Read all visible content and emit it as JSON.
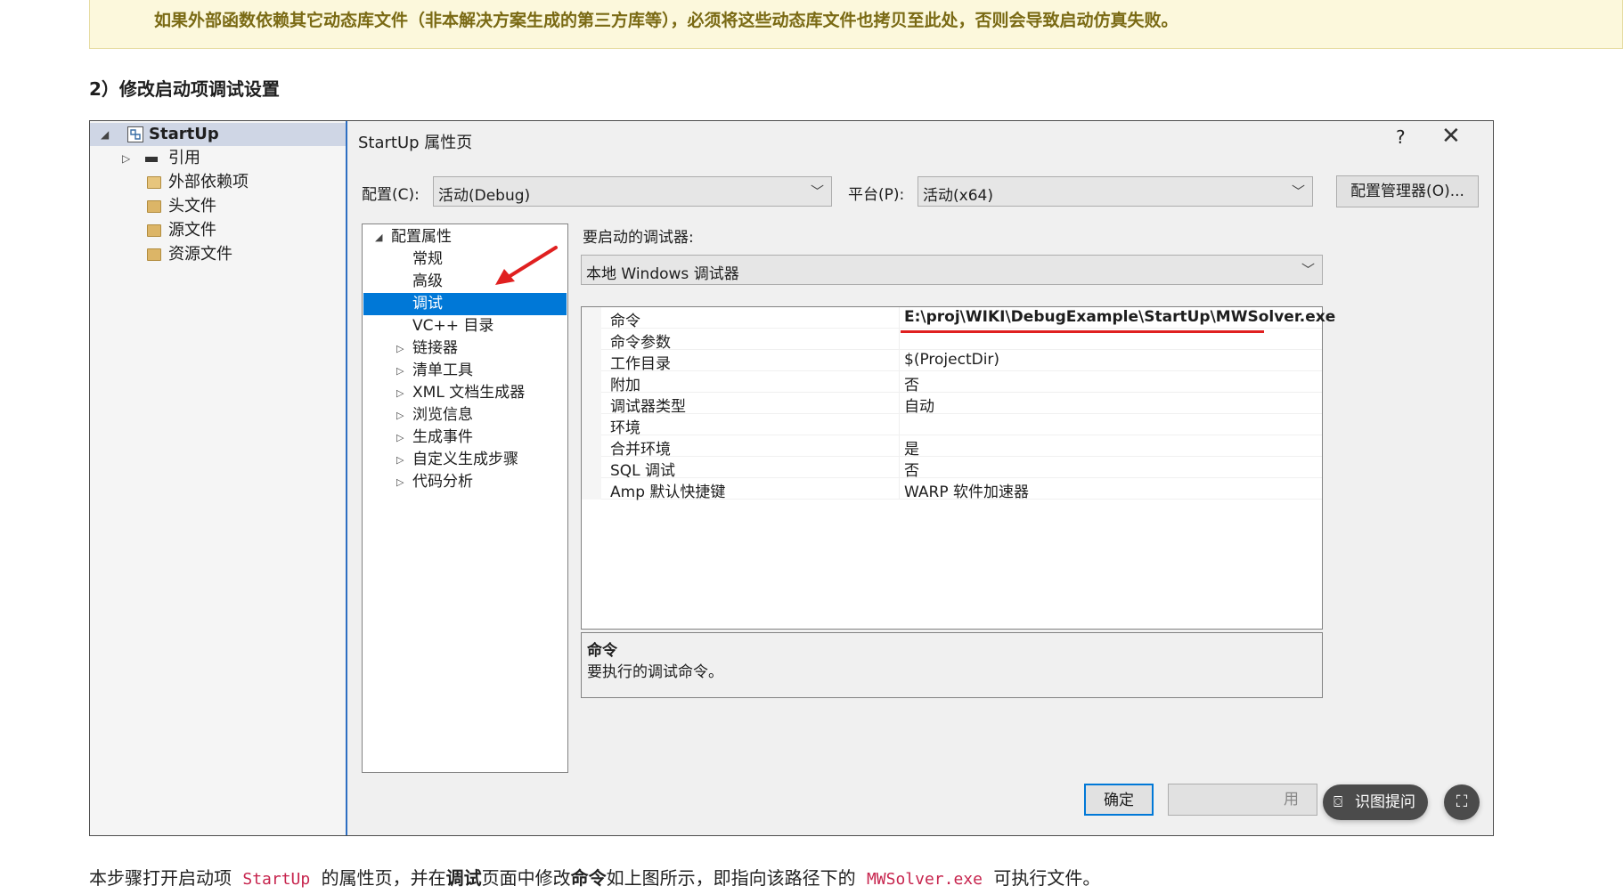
{
  "note": {
    "text": "如果外部函数依赖其它动态库文件（非本解决方案生成的第三方库等），必须将这些动态库文件也拷贝至此处，否则会导致启动仿真失败。"
  },
  "heading": "2）修改启动项调试设置",
  "solution_explorer": {
    "project": "StartUp",
    "items": [
      {
        "label": "引用",
        "icon": "reference-icon"
      },
      {
        "label": "外部依赖项",
        "icon": "external-deps-icon"
      },
      {
        "label": "头文件",
        "icon": "folder-icon"
      },
      {
        "label": "源文件",
        "icon": "folder-icon"
      },
      {
        "label": "资源文件",
        "icon": "folder-icon"
      }
    ]
  },
  "dialog": {
    "title": "StartUp 属性页",
    "help": "?",
    "close": "✕",
    "config_label": "配置(C):",
    "config_value": "活动(Debug)",
    "platform_label": "平台(P):",
    "platform_value": "活动(x64)",
    "config_manager": "配置管理器(O)...",
    "tree": {
      "root": "配置属性",
      "items": [
        "常规",
        "高级",
        "调试",
        "VC++ 目录",
        "链接器",
        "清单工具",
        "XML 文档生成器",
        "浏览信息",
        "生成事件",
        "自定义生成步骤",
        "代码分析"
      ]
    },
    "debugger_label": "要启动的调试器:",
    "debugger_value": "本地 Windows 调试器",
    "props": [
      {
        "k": "命令",
        "v": "E:\\proj\\WIKI\\DebugExample\\StartUp\\MWSolver.exe"
      },
      {
        "k": "命令参数",
        "v": ""
      },
      {
        "k": "工作目录",
        "v": "$(ProjectDir)"
      },
      {
        "k": "附加",
        "v": "否"
      },
      {
        "k": "调试器类型",
        "v": "自动"
      },
      {
        "k": "环境",
        "v": ""
      },
      {
        "k": "合并环境",
        "v": "是"
      },
      {
        "k": "SQL 调试",
        "v": "否"
      },
      {
        "k": "Amp 默认快捷键",
        "v": "WARP 软件加速器"
      }
    ],
    "desc_title": "命令",
    "desc_text": "要执行的调试命令。",
    "ok": "确定",
    "apply_partial": "用"
  },
  "overlay": {
    "ask": "识图提问"
  },
  "caption": {
    "p1": "本步骤打开启动项 ",
    "code1": "StartUp",
    "p2": " 的属性页，并在",
    "b1": "调试",
    "p3": "页面中修改",
    "b2": "命令",
    "p4": "如上图所示，即指向该路径下的 ",
    "code2": "MWSolver.exe",
    "p5": " 可执行文件。"
  },
  "colors": {
    "accent": "#0078d7",
    "annotation": "#e02020",
    "note_bg": "#fcf8dc",
    "note_text": "#7a6a14"
  }
}
